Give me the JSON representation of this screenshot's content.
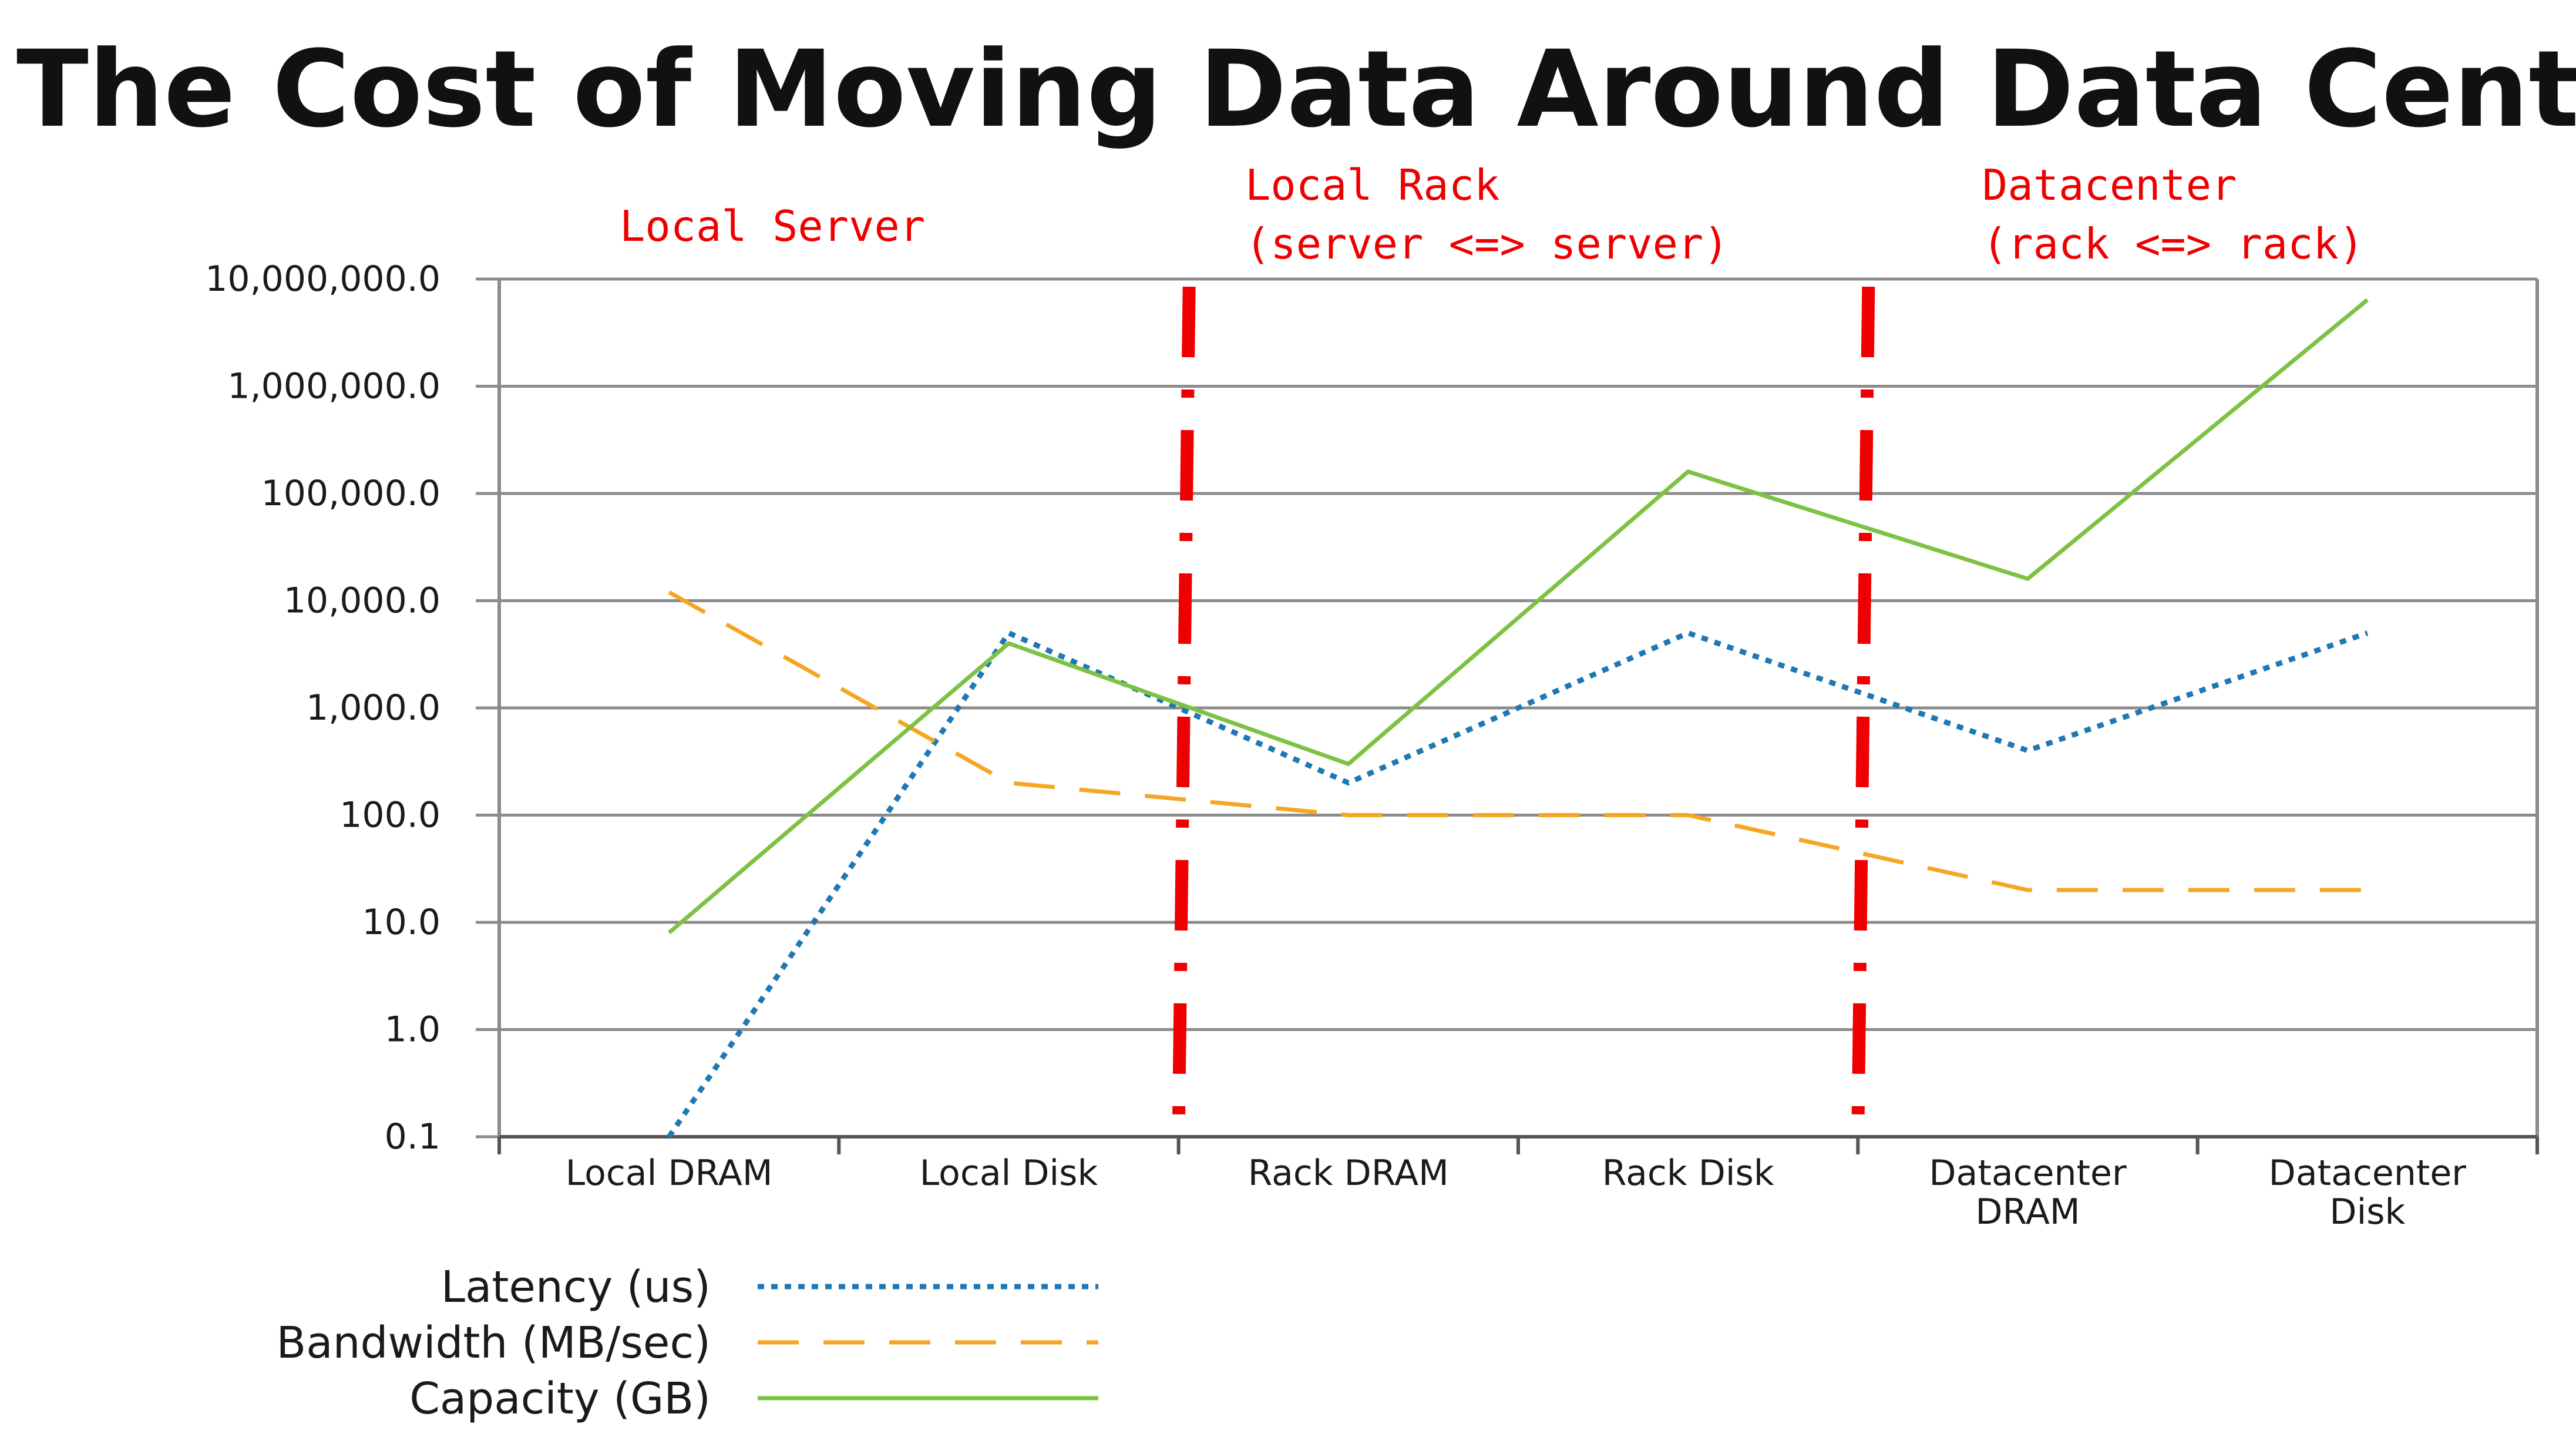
{
  "title": "The Cost of Moving Data Around Data Center",
  "colors": {
    "latency": "#1f77b4",
    "bandwidth": "#f5a623",
    "capacity": "#7dc242",
    "region_divider": "#ee0000",
    "region_text": "#ee0000",
    "grid": "#8c8c8c"
  },
  "regions": [
    {
      "label": [
        "Local Server"
      ]
    },
    {
      "label": [
        "Local Rack",
        "(server <=> server)"
      ]
    },
    {
      "label": [
        "Datacenter",
        "(rack <=> rack)"
      ]
    }
  ],
  "chart_data": {
    "type": "line",
    "y_scale": "log10",
    "ylim": [
      0.1,
      10000000
    ],
    "y_ticks": [
      0.1,
      1,
      10,
      100,
      1000,
      10000,
      100000,
      1000000,
      10000000
    ],
    "y_tick_labels": [
      "0.1",
      "1.0",
      "10.0",
      "100.0",
      "1,000.0",
      "10,000.0",
      "100,000.0",
      "1,000,000.0",
      "10,000,000.0"
    ],
    "categories": [
      [
        "Local DRAM"
      ],
      [
        "Local Disk"
      ],
      [
        "Rack DRAM"
      ],
      [
        "Rack Disk"
      ],
      [
        "Datacenter",
        "DRAM"
      ],
      [
        "Datacenter",
        "Disk"
      ]
    ],
    "grid": true,
    "legend_position": "bottom-left",
    "series": [
      {
        "name": "Latency (us)",
        "style": "dotted",
        "values": [
          0.1,
          5000,
          200,
          5000,
          400,
          5000
        ]
      },
      {
        "name": "Bandwidth (MB/sec)",
        "style": "dashed",
        "values": [
          12000,
          200,
          100,
          100,
          20,
          20
        ]
      },
      {
        "name": "Capacity (GB)",
        "style": "solid",
        "values": [
          8,
          4000,
          300,
          160000,
          16000,
          6400000
        ]
      }
    ],
    "annotations": [
      {
        "type": "vertical-divider",
        "between": [
          1,
          2
        ]
      },
      {
        "type": "vertical-divider",
        "between": [
          3,
          4
        ]
      }
    ]
  }
}
